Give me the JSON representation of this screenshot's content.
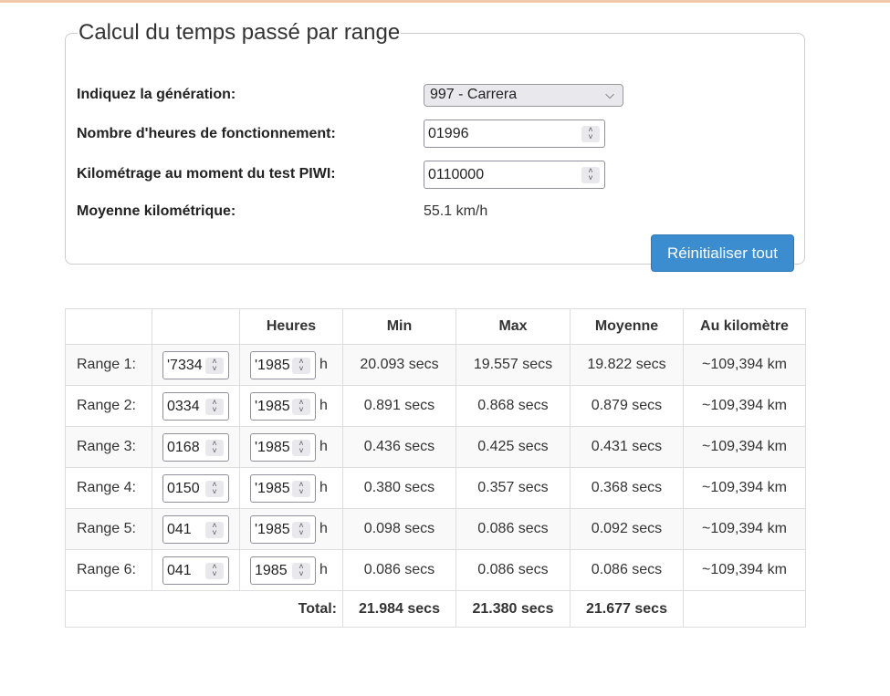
{
  "form": {
    "legend": "Calcul du temps passé par range",
    "generation": {
      "label": "Indiquez la génération:",
      "selected": "997 - Carrera"
    },
    "hours": {
      "label": "Nombre d'heures de fonctionnement:",
      "value": "01996"
    },
    "mileage": {
      "label": "Kilométrage au moment du test PIWI:",
      "value": "0110000"
    },
    "average": {
      "label": "Moyenne kilométrique:",
      "value": "55.1 km/h"
    },
    "reset_label": "Réinitialiser tout"
  },
  "table": {
    "headers": {
      "hours": "Heures",
      "min": "Min",
      "max": "Max",
      "avg": "Moyenne",
      "km": "Au kilomètre"
    },
    "rows": [
      {
        "label": "Range 1:",
        "field1": "'7334",
        "field2": "'1985",
        "unit": "h",
        "min": "20.093 secs",
        "max": "19.557 secs",
        "avg": "19.822 secs",
        "km": "~109,394 km"
      },
      {
        "label": "Range 2:",
        "field1": "0334",
        "field2": "'1985",
        "unit": "h",
        "min": "0.891 secs",
        "max": "0.868 secs",
        "avg": "0.879 secs",
        "km": "~109,394 km"
      },
      {
        "label": "Range 3:",
        "field1": "0168",
        "field2": "'1985",
        "unit": "h",
        "min": "0.436 secs",
        "max": "0.425 secs",
        "avg": "0.431 secs",
        "km": "~109,394 km"
      },
      {
        "label": "Range 4:",
        "field1": "0150",
        "field2": "'1985",
        "unit": "h",
        "min": "0.380 secs",
        "max": "0.357 secs",
        "avg": "0.368 secs",
        "km": "~109,394 km"
      },
      {
        "label": "Range 5:",
        "field1": "041",
        "field2": "'1985",
        "unit": "h",
        "min": "0.098 secs",
        "max": "0.086 secs",
        "avg": "0.092 secs",
        "km": "~109,394 km"
      },
      {
        "label": "Range 6:",
        "field1": "041",
        "field2": "1985",
        "unit": "h",
        "min": "0.086 secs",
        "max": "0.086 secs",
        "avg": "0.086 secs",
        "km": "~109,394 km"
      }
    ],
    "total": {
      "label": "Total:",
      "min": "21.984 secs",
      "max": "21.380 secs",
      "avg": "21.677 secs"
    }
  },
  "colors": {
    "accent_button": "#3b8dd0"
  }
}
